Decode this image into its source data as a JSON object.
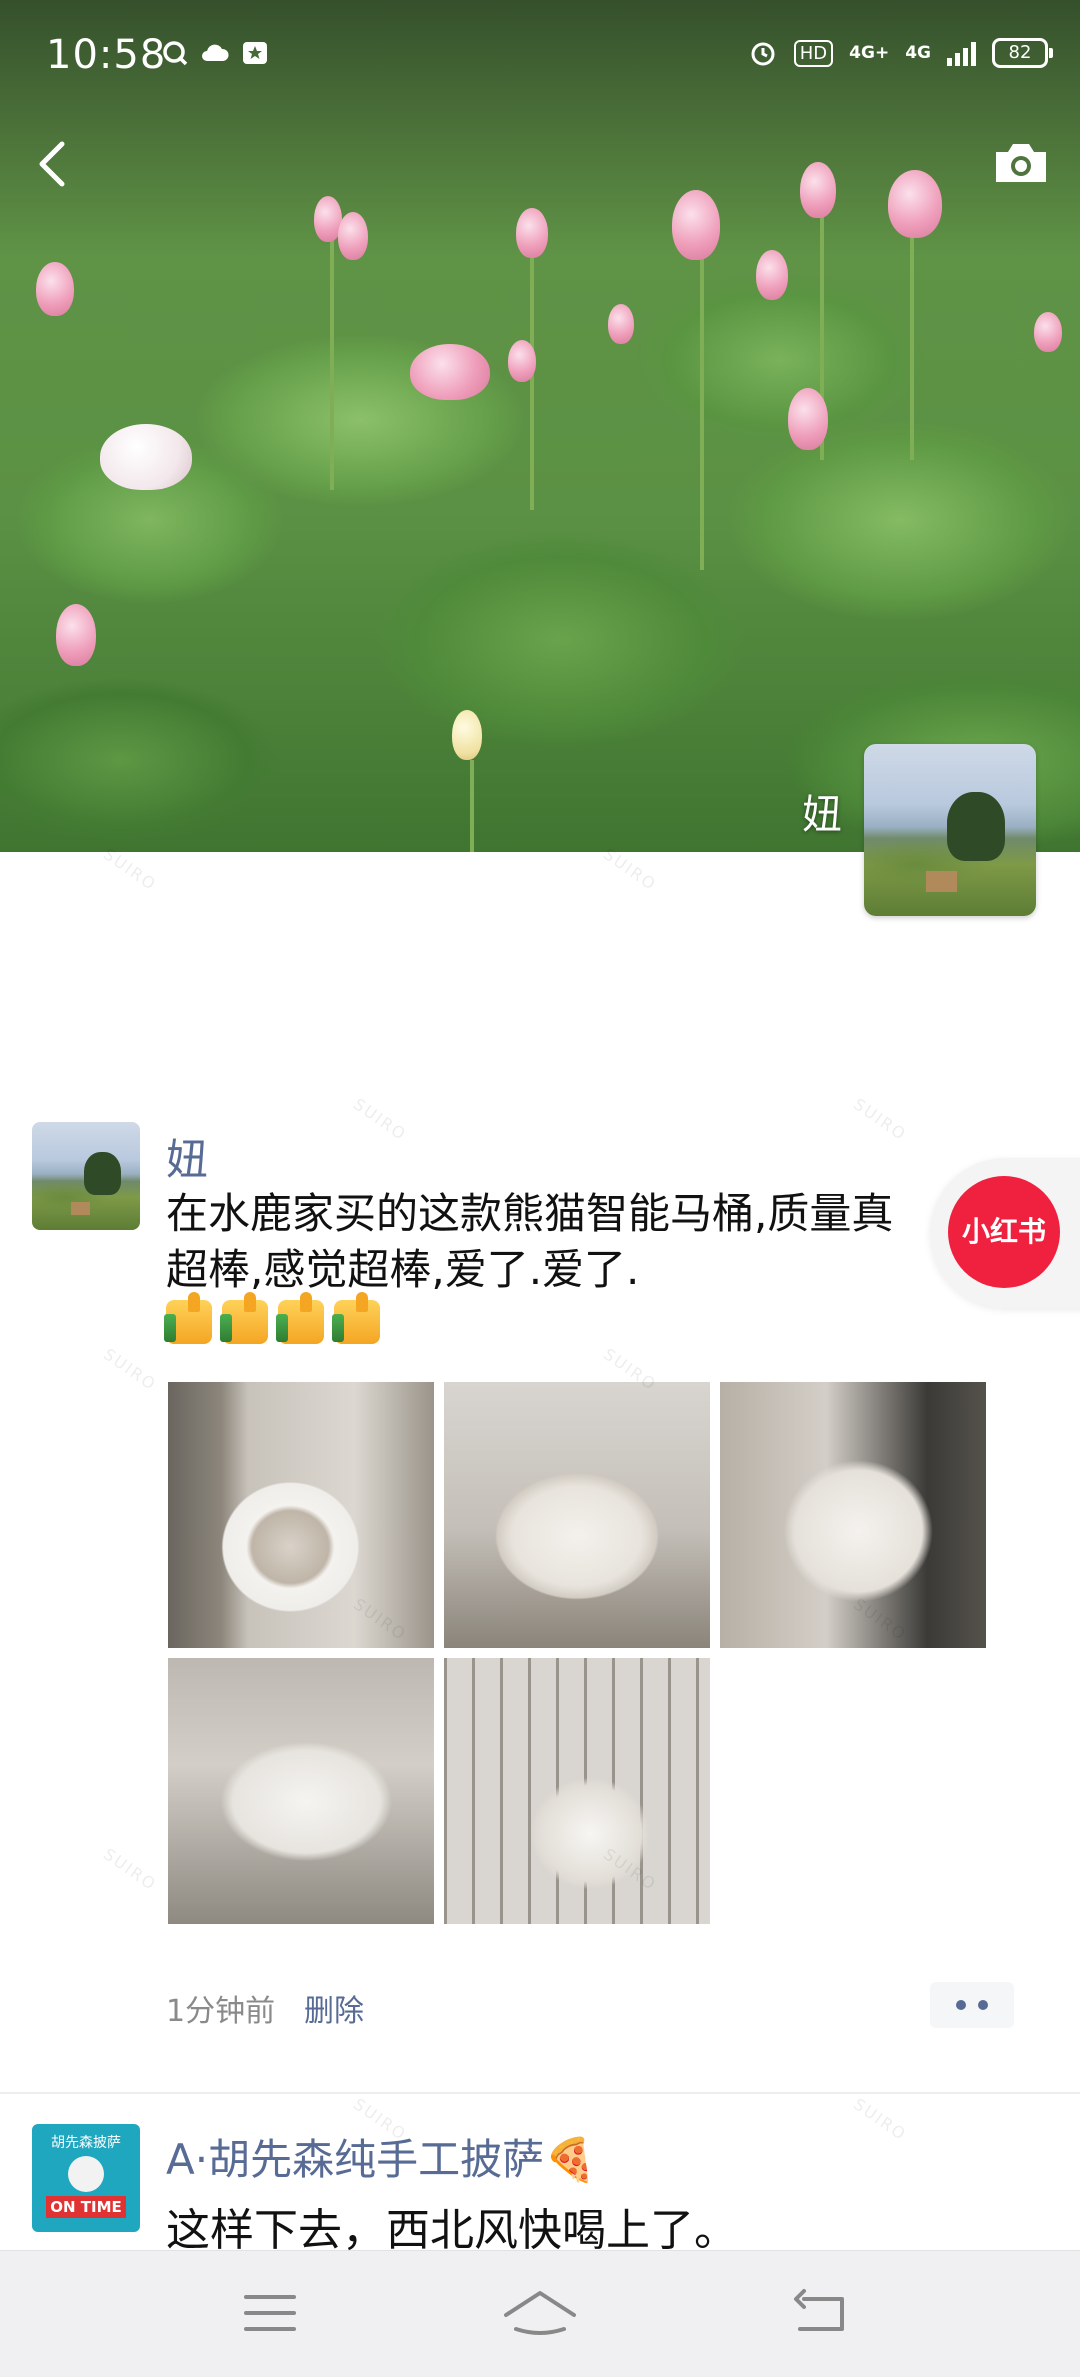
{
  "status_bar": {
    "time": "10:58",
    "hd_label": "HD",
    "net_label_1": "4G+",
    "net_label_2": "4G",
    "battery": "82"
  },
  "profile": {
    "name": "妞"
  },
  "post": {
    "author": "妞",
    "text": "在水鹿家买的这款熊猫智能马桶,质量真\n超棒,感觉超棒,爱了.爱了.",
    "thumbs_count": 4,
    "photos": [
      "photo-1",
      "photo-2",
      "photo-3",
      "photo-4",
      "photo-5"
    ],
    "time_ago": "1分钟前",
    "delete_label": "删除"
  },
  "comment": {
    "author": "A·胡先森纯手工披萨🍕",
    "text": "这样下去，西北风快喝上了。",
    "avatar_line1": "胡先森披萨",
    "avatar_line2": "ON TIME"
  },
  "float_badge": {
    "label": "小红书",
    "color": "#f0213f"
  },
  "watermark": "SUIRO",
  "colors": {
    "link": "#576b95",
    "meta": "#8a8a8a"
  }
}
